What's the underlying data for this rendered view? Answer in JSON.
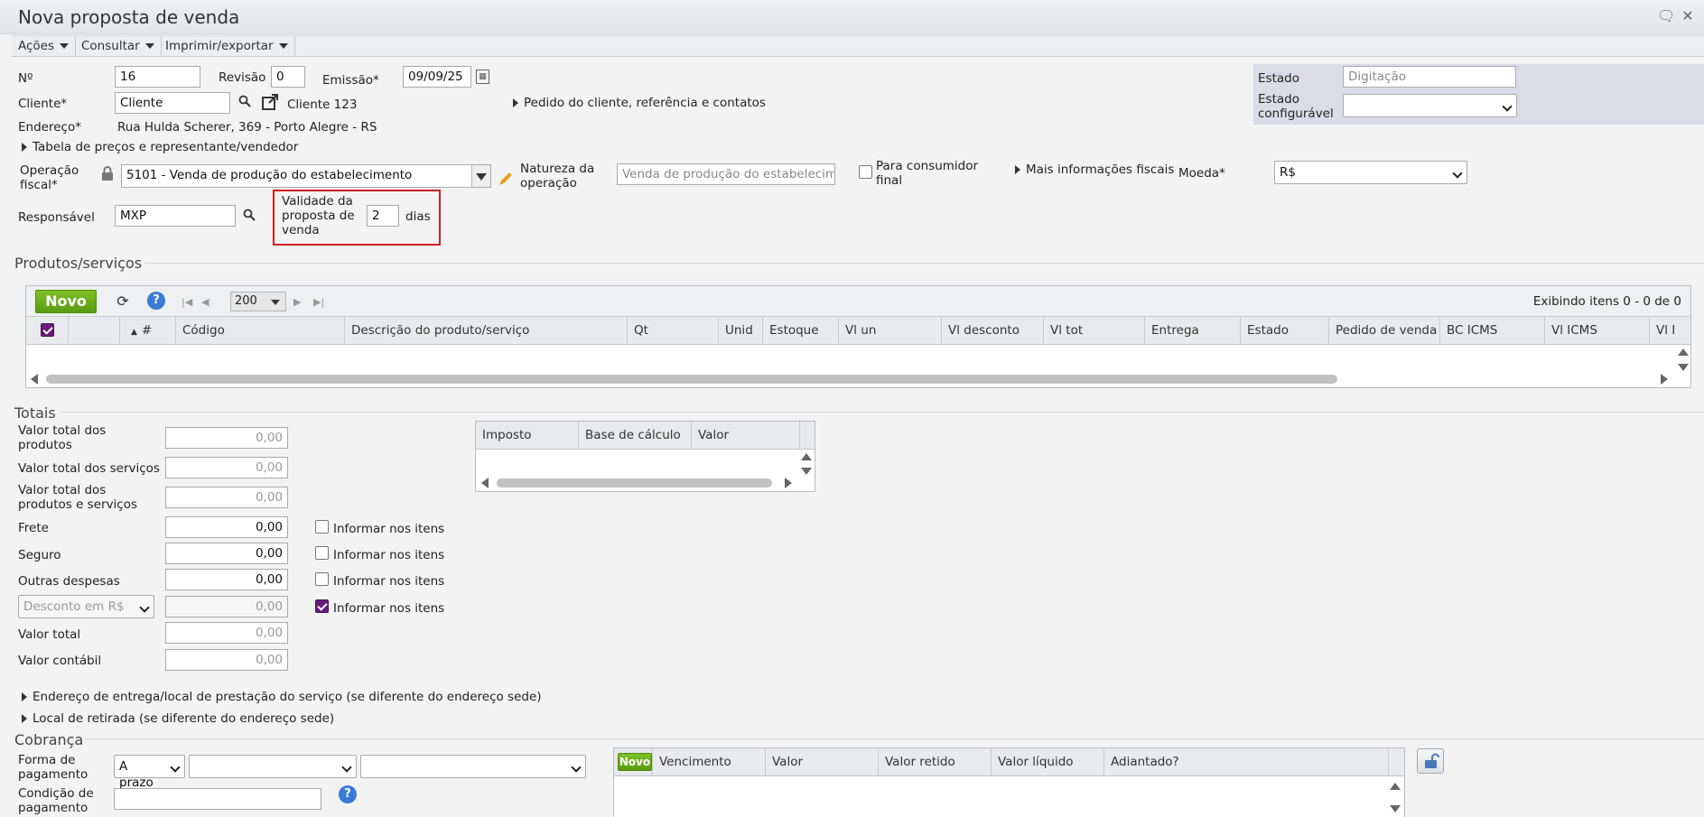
{
  "window": {
    "title": "Nova proposta de venda"
  },
  "menubar": {
    "items": [
      "Ações",
      "Consultar",
      "Imprimir/exportar"
    ]
  },
  "header": {
    "numero_label": "Nº",
    "numero_value": "16",
    "revisao_label": "Revisão",
    "revisao_value": "0",
    "emissao_label": "Emissão*",
    "emissao_value": "09/09/25",
    "cliente_label": "Cliente*",
    "cliente_value": "Cliente",
    "cliente_name": "Cliente 123",
    "pedido_link": "Pedido do cliente, referência e contatos",
    "endereco_label": "Endereço*",
    "endereco_value": "Rua Hulda Scherer, 369 - Porto Alegre - RS",
    "tabela_link": "Tabela de preços e representante/vendedor",
    "operacao_label": "Operação fiscal*",
    "operacao_value": "5101 - Venda de produção do estabelecimento",
    "natureza_label": "Natureza da operação",
    "natureza_value": "Venda de produção do estabelecimento",
    "consumidor_label": "Para consumidor final",
    "fiscais_link": "Mais informações fiscais",
    "moeda_label": "Moeda*",
    "moeda_value": "R$",
    "responsavel_label": "Responsável",
    "responsavel_value": "MXP",
    "validade_label": "Validade da proposta de venda",
    "validade_value": "2",
    "validade_unit": "dias",
    "estado_label": "Estado",
    "estado_value": "Digitação",
    "estado_config_label": "Estado configurável",
    "estado_config_value": ""
  },
  "produtos": {
    "title": "Produtos/serviços",
    "novo_label": "Novo",
    "page_size": "200",
    "status": "Exibindo itens 0 - 0 de 0",
    "columns": [
      "#",
      "Código",
      "Descrição do produto/serviço",
      "Qt",
      "Unid",
      "Estoque",
      "Vl un",
      "Vl desconto",
      "Vl tot",
      "Entrega",
      "Estado",
      "Pedido de venda",
      "BC ICMS",
      "Vl ICMS",
      "Vl I"
    ]
  },
  "totais": {
    "title": "Totais",
    "rows": [
      {
        "label": "Valor total dos produtos",
        "value": "0,00"
      },
      {
        "label": "Valor total dos serviços",
        "value": "0,00"
      },
      {
        "label": "Valor total dos produtos e serviços",
        "value": "0,00"
      },
      {
        "label": "Frete",
        "value": "0,00",
        "check": "Informar nos itens"
      },
      {
        "label": "Seguro",
        "value": "0,00",
        "check": "Informar nos itens"
      },
      {
        "label": "Outras despesas",
        "value": "0,00",
        "check": "Informar nos itens"
      },
      {
        "label": "Desconto em R$",
        "value": "0,00",
        "check": "Informar nos itens"
      },
      {
        "label": "Valor total",
        "value": "0,00"
      },
      {
        "label": "Valor contábil",
        "value": "0,00"
      }
    ],
    "impostos_columns": [
      "Imposto",
      "Base de cálculo",
      "Valor"
    ]
  },
  "links": {
    "entrega": "Endereço de entrega/local de prestação do serviço (se diferente do endereço sede)",
    "retirada": "Local de retirada (se diferente do endereço sede)"
  },
  "cobranca": {
    "title": "Cobrança",
    "forma_label": "Forma de pagamento",
    "forma_value": "A prazo",
    "condicao_label": "Condição de pagamento",
    "novo_label": "Novo",
    "columns": [
      "Vencimento",
      "Valor",
      "Valor retido",
      "Valor líquido",
      "Adiantado?"
    ]
  }
}
